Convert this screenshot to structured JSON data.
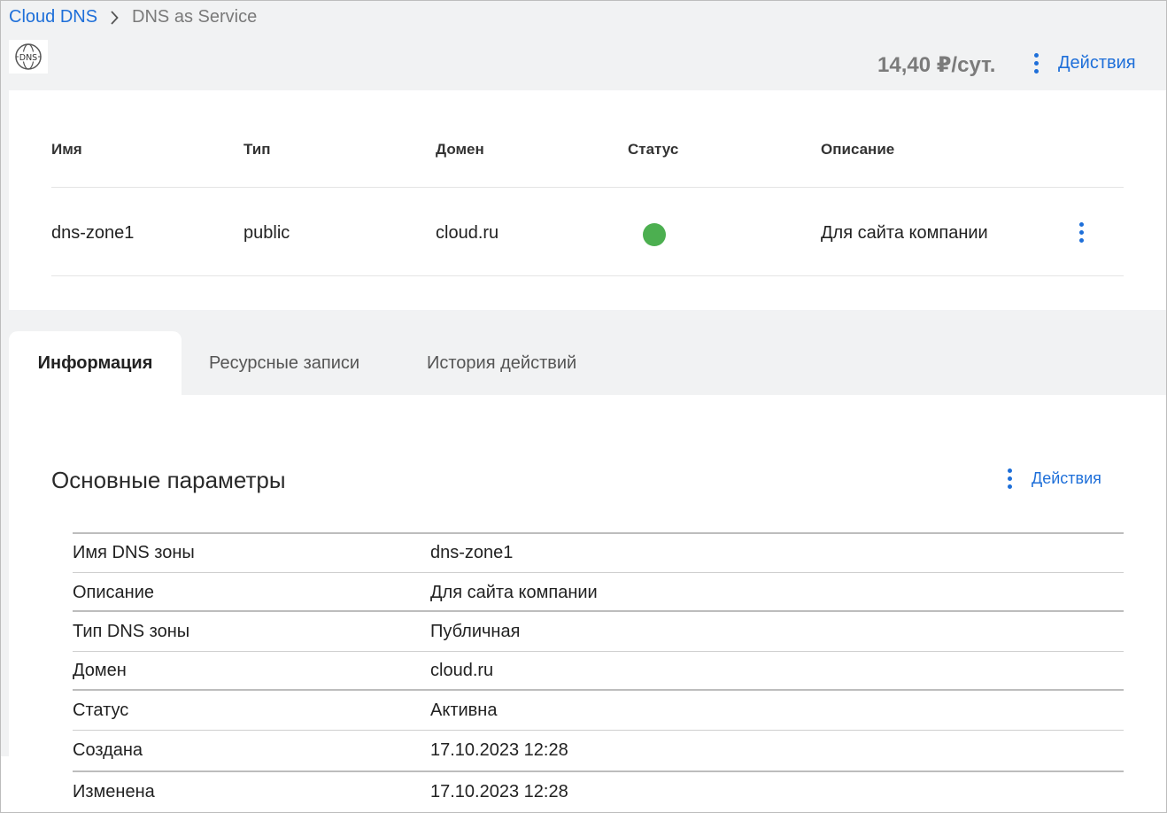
{
  "breadcrumb": {
    "root": "Cloud DNS",
    "current": "DNS as Service"
  },
  "logo": {
    "text": "DNS"
  },
  "header": {
    "price": "14,40 ₽/сут.",
    "actions_label": "Действия"
  },
  "zones_table": {
    "columns": [
      "Имя",
      "Тип",
      "Домен",
      "Статус",
      "Описание"
    ],
    "rows": [
      {
        "name": "dns-zone1",
        "type": "public",
        "domain": "cloud.ru",
        "status_color": "#4caf50",
        "description": "Для сайта компании"
      }
    ]
  },
  "tabs": [
    {
      "label": "Информация",
      "active": true
    },
    {
      "label": "Ресурсные записи",
      "active": false
    },
    {
      "label": "История действий",
      "active": false
    }
  ],
  "info": {
    "title": "Основные параметры",
    "actions_label": "Действия",
    "params": [
      {
        "key": "Имя DNS зоны",
        "value": "dns-zone1"
      },
      {
        "key": "Описание",
        "value": "Для сайта компании"
      },
      {
        "key": "Тип DNS зоны",
        "value": "Публичная"
      },
      {
        "key": "Домен",
        "value": "cloud.ru"
      },
      {
        "key": "Статус",
        "value": "Активна"
      },
      {
        "key": "Создана",
        "value": "17.10.2023 12:28"
      },
      {
        "key": "Изменена",
        "value": "17.10.2023 12:28"
      }
    ]
  },
  "colors": {
    "accent": "#1e6fd9",
    "status_active": "#4caf50",
    "background": "#f1f2f3"
  }
}
